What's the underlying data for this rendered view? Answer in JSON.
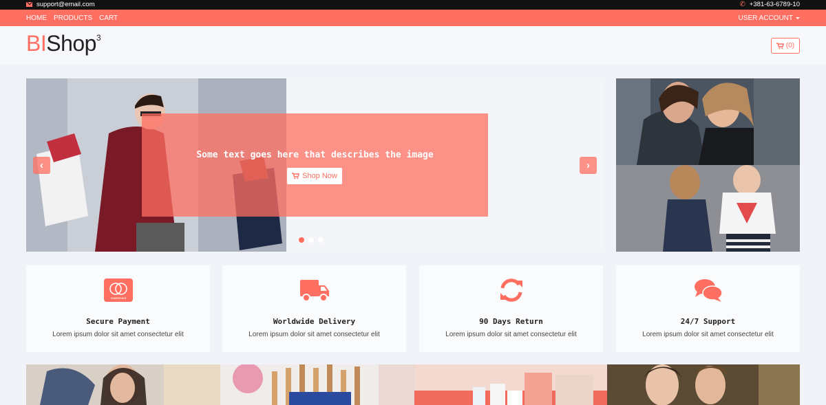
{
  "topbar": {
    "email": "support@email.com",
    "phone": "+381-63-6789-10"
  },
  "nav": {
    "links": [
      "HOME",
      "PRODUCTS",
      "CART"
    ],
    "account": "USER ACCOUNT"
  },
  "header": {
    "logo_bi": "BI",
    "logo_shop": "Shop",
    "logo_sup": "3",
    "cart_count": "(0)"
  },
  "slider": {
    "caption": "Some text goes here that describes the image",
    "button": "Shop Now",
    "slide_count": 3,
    "active_slide": 1
  },
  "features": [
    {
      "icon": "credit-card-icon",
      "title": "Secure Payment",
      "desc": "Lorem ipsum dolor sit amet consectetur elit",
      "card_label": "mastercard"
    },
    {
      "icon": "truck-icon",
      "title": "Worldwide Delivery",
      "desc": "Lorem ipsum dolor sit amet consectetur elit"
    },
    {
      "icon": "refresh-icon",
      "title": "90 Days Return",
      "desc": "Lorem ipsum dolor sit amet consectetur elit"
    },
    {
      "icon": "comments-icon",
      "title": "24/7 Support",
      "desc": "Lorem ipsum dolor sit amet consectetur elit"
    }
  ],
  "colors": {
    "accent": "#ff6f61",
    "topbar": "#111111",
    "background": "#f1f3f8"
  }
}
